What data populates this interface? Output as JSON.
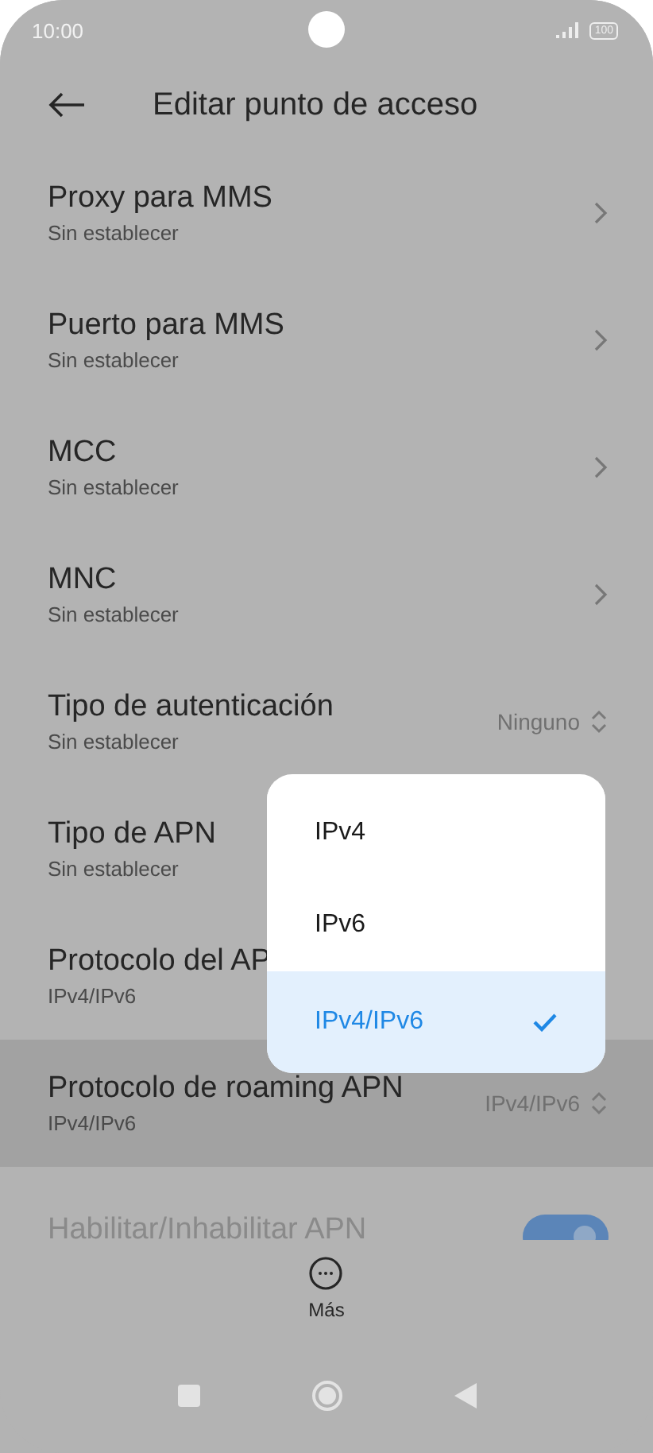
{
  "status_bar": {
    "time": "10:00",
    "battery": "100"
  },
  "header": {
    "title": "Editar punto de acceso"
  },
  "rows": [
    {
      "kind": "chevron",
      "title": "Proxy para MMS",
      "subtitle": "Sin establecer",
      "highlighted": false
    },
    {
      "kind": "chevron",
      "title": "Puerto para MMS",
      "subtitle": "Sin establecer",
      "highlighted": false
    },
    {
      "kind": "chevron",
      "title": "MCC",
      "subtitle": "Sin establecer",
      "highlighted": false
    },
    {
      "kind": "chevron",
      "title": "MNC",
      "subtitle": "Sin establecer",
      "highlighted": false
    },
    {
      "kind": "select",
      "title": "Tipo de autenticación",
      "subtitle": "Sin establecer",
      "value": "Ninguno",
      "highlighted": false
    },
    {
      "kind": "plain",
      "title": "Tipo de APN",
      "subtitle": "Sin establecer",
      "highlighted": false
    },
    {
      "kind": "plain",
      "title": "Protocolo del AP",
      "subtitle": "IPv4/IPv6",
      "highlighted": false
    },
    {
      "kind": "select",
      "title": "Protocolo de roaming APN",
      "subtitle": "IPv4/IPv6",
      "value": "IPv4/IPv6",
      "highlighted": true
    },
    {
      "kind": "toggle",
      "title": "Habilitar/Inhabilitar APN",
      "on": true,
      "highlighted": false
    }
  ],
  "popup": {
    "options": [
      {
        "label": "IPv4",
        "selected": false
      },
      {
        "label": "IPv6",
        "selected": false
      },
      {
        "label": "IPv4/IPv6",
        "selected": true
      }
    ]
  },
  "bottom_bar": {
    "label": "Más"
  }
}
